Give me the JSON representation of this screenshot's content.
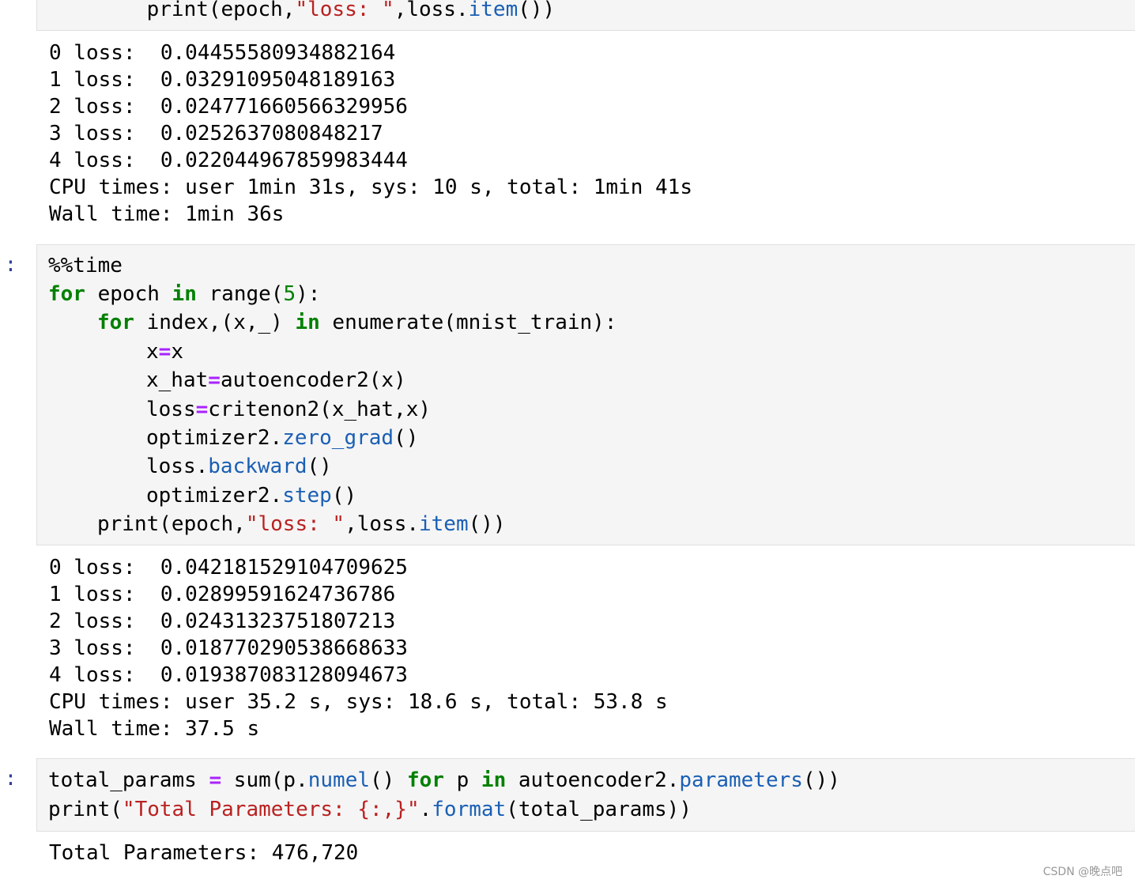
{
  "cell0": {
    "last_line_parts": [
      "    print(epoch,",
      "\"loss: \"",
      ",loss.",
      "item",
      "())"
    ],
    "output": [
      "0 loss:  0.044555809348821​64",
      "1 loss:  0.03291095048189163",
      "2 loss:  0.024771660566329956",
      "3 loss:  0.0252637080848217",
      "4 loss:  0.022044967859983444",
      "CPU times: user 1min 31s, sys: 10 s, total: 1min 41s",
      "Wall time: 1min 36s"
    ]
  },
  "cell1": {
    "prompt": "]:",
    "code": {
      "l1": "%%time",
      "l2_kw": "for",
      "l2_a": " epoch ",
      "l2_kw2": "in",
      "l2_b": " range(",
      "l2_num": "5",
      "l2_c": "):",
      "l3_kw": "for",
      "l3_a": " index,(x,_) ",
      "l3_kw2": "in",
      "l3_b": " enumerate(mnist_train):",
      "l4_a": "x",
      "l4_op": "=",
      "l4_b": "x",
      "l5_a": "x_hat",
      "l5_op": "=",
      "l5_b": "autoencoder2(x)",
      "l6_a": "loss",
      "l6_op": "=",
      "l6_b": "critenon2(x_hat,x)",
      "l7_a": "optimizer2.",
      "l7_fn": "zero_grad",
      "l7_b": "()",
      "l8_a": "loss.",
      "l8_fn": "backward",
      "l8_b": "()",
      "l9_a": "optimizer2.",
      "l9_fn": "step",
      "l9_b": "()",
      "l10_a": "print(epoch,",
      "l10_str": "\"loss: \"",
      "l10_b": ",loss.",
      "l10_fn": "item",
      "l10_c": "())"
    },
    "output": [
      "0 loss:  0.042181529104709625",
      "1 loss:  0.02899591624736786",
      "2 loss:  0.02431323751807213",
      "3 loss:  0.018770290538668633",
      "4 loss:  0.019387083128094673",
      "CPU times: user 35.2 s, sys: 18.6 s, total: 53.8 s",
      "Wall time: 37.5 s"
    ]
  },
  "cell2": {
    "prompt": "]:",
    "code": {
      "l1_a": "total_params ",
      "l1_op": "=",
      "l1_b": " sum(p.",
      "l1_fn": "numel",
      "l1_c": "() ",
      "l1_kw": "for",
      "l1_d": " p ",
      "l1_kw2": "in",
      "l1_e": " autoencoder2.",
      "l1_fn2": "parameters",
      "l1_f": "())",
      "l2_a": "print(",
      "l2_str": "\"Total Parameters: {:,}\"",
      "l2_b": ".",
      "l2_fn": "format",
      "l2_c": "(total_params))"
    },
    "output": [
      "Total Parameters: 476,720"
    ]
  },
  "watermark": "CSDN @晚点吧"
}
